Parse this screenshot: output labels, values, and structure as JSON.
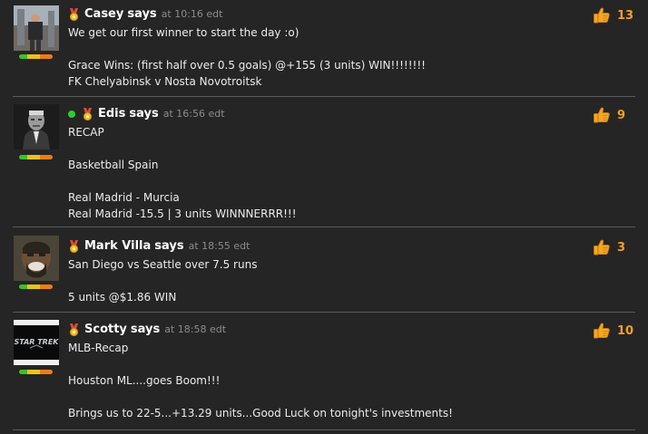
{
  "posts": [
    {
      "author": "Casey",
      "says": "says",
      "time": "at 10:16 edt",
      "likes": "13",
      "online": false,
      "lines": [
        "We get our first winner to start the day :o)",
        "",
        "Grace Wins: (first half over 0.5 goals) @+155 (3 units) WIN!!!!!!!!",
        "FK Chelyabinsk v Nosta Novotroitsk"
      ]
    },
    {
      "author": "Edis",
      "says": "says",
      "time": "at 16:56 edt",
      "likes": "9",
      "online": true,
      "lines": [
        "RECAP",
        "",
        "Basketball Spain",
        "",
        "Real Madrid - Murcia",
        "Real Madrid -15.5 | 3 units WINNNERRR!!!"
      ]
    },
    {
      "author": "Mark Villa",
      "says": "says",
      "time": "at 18:55 edt",
      "likes": "3",
      "online": false,
      "lines": [
        "San Diego vs Seattle over 7.5 runs",
        "",
        "5 units @$1.86 WIN"
      ]
    },
    {
      "author": "Scotty",
      "says": "says",
      "time": "at 18:58 edt",
      "likes": "10",
      "online": false,
      "avatar_text": "STAR TREK",
      "lines": [
        "MLB-Recap",
        "",
        "Houston ML....goes Boom!!!",
        "",
        "Brings us to 22-5...+13.29 units...Good Luck on tonight's investments!"
      ]
    }
  ],
  "colors": {
    "accent": "#f2a024",
    "online": "#2fcc2f",
    "background": "#252525"
  },
  "icons": {
    "like": "thumbs-up-icon",
    "badge": "medal-icon"
  }
}
